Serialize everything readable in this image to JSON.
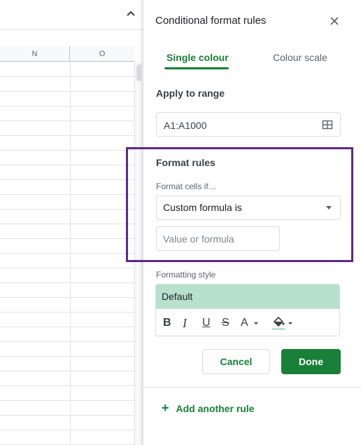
{
  "spreadsheet": {
    "columns": [
      "N",
      "O"
    ]
  },
  "panel": {
    "title": "Conditional format rules",
    "tabs": [
      {
        "label": "Single colour",
        "active": true
      },
      {
        "label": "Colour scale",
        "active": false
      }
    ],
    "apply_to_range": {
      "label": "Apply to range",
      "value": "A1:A1000"
    },
    "format_rules": {
      "label": "Format rules",
      "condition_label": "Format cells if…",
      "condition_value": "Custom formula is",
      "value_placeholder": "Value or formula"
    },
    "formatting_style": {
      "label": "Formatting style",
      "preset": "Default",
      "preview_color": "#b7e1cd",
      "tools": {
        "bold": "B",
        "italic": "I",
        "underline": "U",
        "strikethrough": "S",
        "text_color": "A"
      }
    },
    "buttons": {
      "cancel": "Cancel",
      "done": "Done"
    },
    "add_rule": "Add another rule"
  },
  "colors": {
    "accent_green": "#188038",
    "highlight_purple": "#5b2a86"
  }
}
